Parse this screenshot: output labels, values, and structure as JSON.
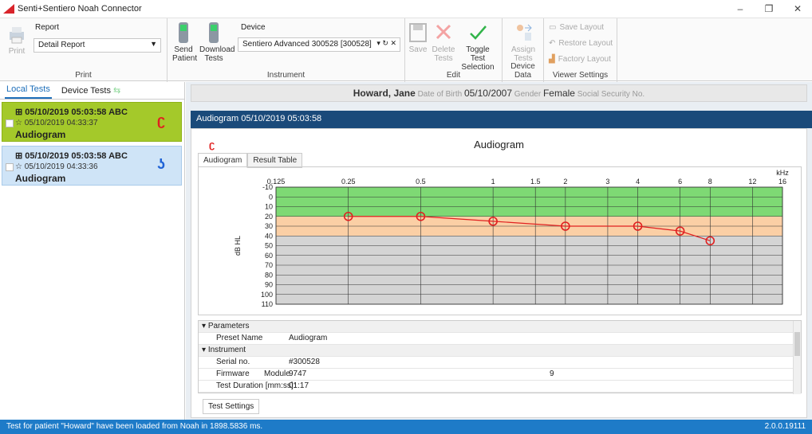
{
  "app": {
    "title": "Senti+Sentiero Noah Connector"
  },
  "window_controls": {
    "minimize": "–",
    "restore": "❐",
    "close": "✕"
  },
  "ribbon": {
    "print_group": {
      "report_label": "Report",
      "report_value": "Detail Report",
      "print_label": "Print",
      "group_label": "Print"
    },
    "instrument_group": {
      "send_patient": "Send Patient",
      "download_tests": "Download Tests",
      "device_label": "Device",
      "device_value": "Sentiero Advanced 300528 [300528]",
      "group_label": "Instrument"
    },
    "edit_group": {
      "save": "Save",
      "delete_tests": "Delete Tests",
      "toggle_selection": "Toggle Test Selection",
      "group_label": "Edit"
    },
    "device_data_group": {
      "assign_tests": "Assign Tests",
      "group_label": "Device Data"
    },
    "viewer_group": {
      "save_layout": "Save Layout",
      "restore_layout": "Restore Layout",
      "factory_layout": "Factory Layout",
      "group_label": "Viewer Settings"
    }
  },
  "left_panel": {
    "tabs": [
      {
        "label": "Local Tests"
      },
      {
        "label": "Device Tests"
      }
    ],
    "cards": [
      {
        "line1": "05/10/2019 05:03:58 ABC",
        "line2": "05/10/2019 04:33:37",
        "line3": "Audiogram",
        "ear": "right"
      },
      {
        "line1": "05/10/2019 05:03:58 ABC",
        "line2": "05/10/2019 04:33:36",
        "line3": "Audiogram",
        "ear": "left"
      }
    ]
  },
  "patient": {
    "name": "Howard, Jane",
    "dob_label": "Date of Birth",
    "dob": "05/10/2007",
    "gender_label": "Gender",
    "gender": "Female",
    "ssn_label": "Social Security No."
  },
  "audiogram": {
    "header": "Audiogram 05/10/2019 05:03:58",
    "title": "Audiogram",
    "tabs": [
      {
        "label": "Audiogram"
      },
      {
        "label": "Result Table"
      }
    ]
  },
  "chart_data": {
    "type": "line",
    "title": "",
    "xlabel": "kHz",
    "ylabel": "dB HL",
    "x_ticks": [
      "0.125",
      "0.25",
      "0.5",
      "1",
      "1.5",
      "2",
      "3",
      "4",
      "6",
      "8",
      "12",
      "16"
    ],
    "y_ticks": [
      "-10",
      "0",
      "10",
      "20",
      "30",
      "40",
      "50",
      "60",
      "70",
      "80",
      "90",
      "100",
      "110"
    ],
    "ylim": [
      -10,
      110
    ],
    "x_scale": "log",
    "grid": true,
    "bands": [
      {
        "from": -10,
        "to": 20,
        "color": "#7ed974"
      },
      {
        "from": 20,
        "to": 40,
        "color": "#fbcfa5"
      },
      {
        "from": 40,
        "to": 110,
        "color": "#d4d4d4"
      }
    ],
    "series": [
      {
        "ear": "right",
        "color": "#e02020",
        "x": [
          0.25,
          0.5,
          1,
          2,
          4,
          6,
          8
        ],
        "y": [
          20,
          20,
          25,
          30,
          30,
          35,
          45
        ]
      }
    ]
  },
  "parameters": [
    {
      "section": "Parameters"
    },
    {
      "key": "Preset Name",
      "value": "Audiogram"
    },
    {
      "section": "Instrument"
    },
    {
      "key": "Serial no.",
      "value": "#300528"
    },
    {
      "key": "Firmware",
      "key2": "Module",
      "value": "9747",
      "value2": "9"
    },
    {
      "key": "Test Duration [mm:ss]:",
      "value": "01:17"
    }
  ],
  "test_settings_label": "Test Settings",
  "status": {
    "message": "Test for patient \"Howard\" have been loaded from Noah in 1898.5836 ms.",
    "version": "2.0.0.19111"
  },
  "colors": {
    "accent": "#1e6fba",
    "header_dark": "#1a4a7a",
    "status_bar": "#1e7bc8",
    "selected_card": "#a4c92a",
    "unselected_card": "#cfe4f7",
    "right_ear": "#e02020",
    "left_ear": "#2063d6"
  }
}
